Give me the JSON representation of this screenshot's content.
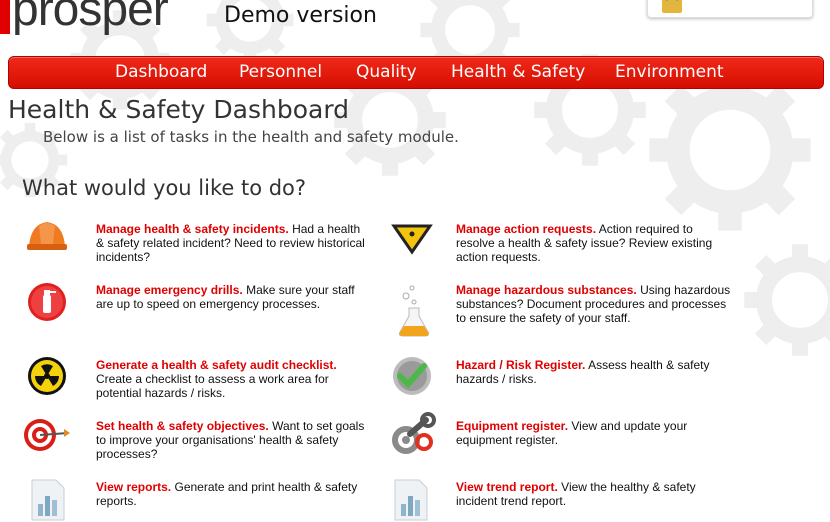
{
  "header": {
    "logo_text": "prosper",
    "demo_label": "Demo version"
  },
  "nav": {
    "items": [
      "Dashboard",
      "Personnel",
      "Quality",
      "Health & Safety",
      "Environment"
    ]
  },
  "page": {
    "title": "Health & Safety Dashboard",
    "subtitle": "Below is a list of tasks in the health and safety module.",
    "prompt": "What would you like to do?"
  },
  "tasks": [
    {
      "icon": "hard-hat-icon",
      "link": "Manage health & safety incidents.",
      "desc": "Had a health & safety related incident? Need to review historical incidents?"
    },
    {
      "icon": "warning-sign-icon",
      "link": "Manage action requests.",
      "desc": "Action required to resolve a health & safety issue? Review existing action requests."
    },
    {
      "icon": "fire-extinguisher-icon",
      "link": "Manage emergency drills.",
      "desc": "Make sure your staff are up to speed on emergency processes."
    },
    {
      "icon": "flask-icon",
      "link": "Manage hazardous substances.",
      "desc": "Using hazardous substances? Document procedures and processes to ensure the safety of your staff."
    },
    {
      "icon": "radiation-icon",
      "link": "Generate a health & safety audit checklist.",
      "desc": "Create a checklist to assess a work area for potential hazards / risks."
    },
    {
      "icon": "checkmark-icon",
      "link": "Hazard / Risk Register.",
      "desc": "Assess health & safety hazards / risks."
    },
    {
      "icon": "target-icon",
      "link": "Set health & safety objectives.",
      "desc": "Want to set goals to improve your organisations' health & safety processes?"
    },
    {
      "icon": "gear-wrench-icon",
      "link": "Equipment register.",
      "desc": "View and update your equipment register."
    },
    {
      "icon": "bar-chart-icon",
      "link": "View reports.",
      "desc": "Generate and print health & safety reports."
    },
    {
      "icon": "bar-chart-icon",
      "link": "View trend report.",
      "desc": "View the healthy & safety incident trend report."
    }
  ]
}
